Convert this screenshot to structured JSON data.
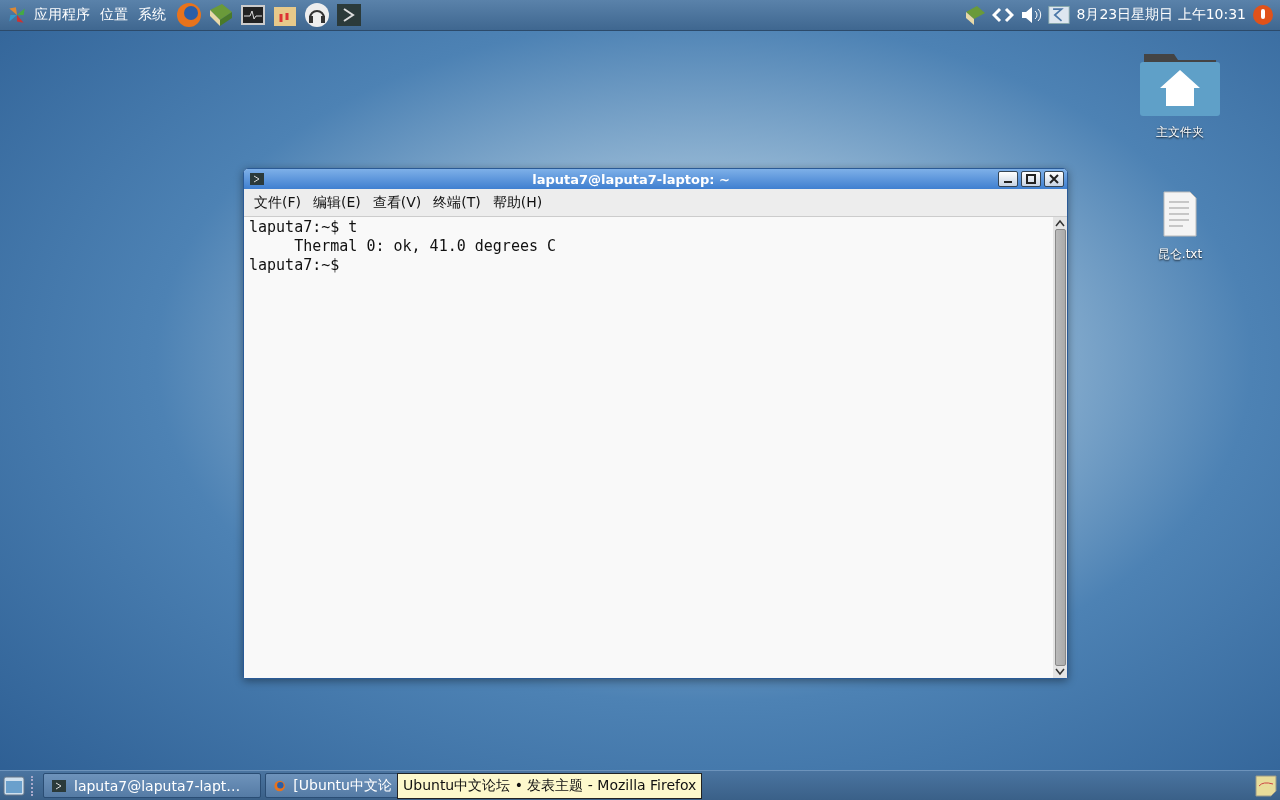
{
  "top_panel": {
    "menus": [
      "应用程序",
      "位置",
      "系统"
    ],
    "clock": "8月23日星期日 上午10:31"
  },
  "desktop_icons": [
    {
      "kind": "home-folder",
      "label": "主文件夹"
    },
    {
      "kind": "text-file",
      "label": "昆仑.txt"
    }
  ],
  "terminal": {
    "title": "laputa7@laputa7-laptop: ~",
    "menu": [
      "文件(F)",
      "编辑(E)",
      "查看(V)",
      "终端(T)",
      "帮助(H)"
    ],
    "lines": [
      "laputa7:~$ t",
      "     Thermal 0: ok, 41.0 degrees C",
      "laputa7:~$"
    ]
  },
  "taskbar": {
    "buttons": [
      {
        "kind": "terminal",
        "label": "laputa7@laputa7-lapt…",
        "selected": false
      },
      {
        "kind": "browser",
        "label": "[Ubuntu中文论",
        "selected": false
      }
    ],
    "tooltip": "Ubuntu中文论坛 • 发表主题 - Mozilla Firefox"
  }
}
